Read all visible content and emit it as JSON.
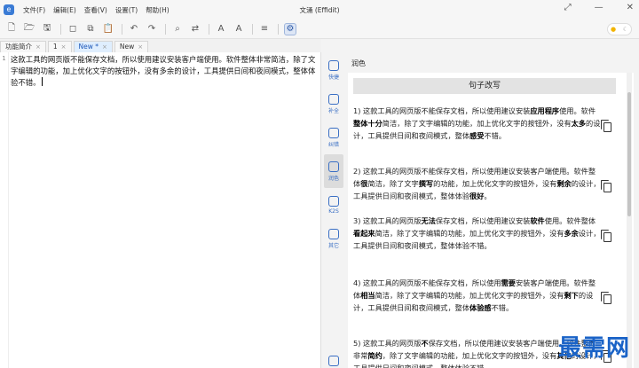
{
  "window": {
    "title": "文涌 (Effidit)",
    "menu": [
      "文件(F)",
      "编辑(E)",
      "查看(V)",
      "设置(T)",
      "帮助(H)"
    ]
  },
  "tabs": [
    {
      "label": "功能简介",
      "active": false
    },
    {
      "label": "1",
      "active": false
    },
    {
      "label": "New *",
      "active": true
    },
    {
      "label": "New",
      "active": false
    }
  ],
  "editor": {
    "line_number": "1",
    "text": "这款工具的网页版不能保存文档，所以使用建议安装客户端使用。软件整体非常简洁，除了文字编辑的功能，加上优化文字的按钮外，没有多余的设计，工具提供日间和夜间模式，整体体验不错。"
  },
  "sidenav": [
    {
      "label": "快捷"
    },
    {
      "label": "补全"
    },
    {
      "label": "纠错"
    },
    {
      "label": "润色",
      "active": true
    },
    {
      "label": "K2S"
    },
    {
      "label": "其它"
    }
  ],
  "panel": {
    "title": "润色",
    "header": "句子改写",
    "suggestions": [
      {
        "segments": [
          {
            "t": "1) 这款工具的网页版不能保存文档，所以使用建议安装"
          },
          {
            "t": "应用程序",
            "b": true
          },
          {
            "t": "使用。软件"
          },
          {
            "t": "整体十分",
            "b": true
          },
          {
            "t": "简洁，除了文字编辑的功能，加上优化文字的按钮外，没有"
          },
          {
            "t": "太多",
            "b": true
          },
          {
            "t": "的设计，工具提供日间和夜间模式，整体"
          },
          {
            "t": "感受",
            "b": true
          },
          {
            "t": "不错。"
          }
        ]
      },
      {
        "segments": [
          {
            "t": "2) 这款工具的网页版不能保存文档，所以使用建议安装客户端使用。软件整体"
          },
          {
            "t": "很",
            "b": true
          },
          {
            "t": "简洁，除了文字"
          },
          {
            "t": "撰写",
            "b": true
          },
          {
            "t": "的功能，加上优化文字的按钮外，没有"
          },
          {
            "t": "剩余",
            "b": true
          },
          {
            "t": "的设计，工具提供日间和夜间模式，整体体验"
          },
          {
            "t": "很好",
            "b": true
          },
          {
            "t": "。"
          }
        ]
      },
      {
        "segments": [
          {
            "t": "3) 这款工具的网页版"
          },
          {
            "t": "无法",
            "b": true
          },
          {
            "t": "保存文档，所以使用建议安装"
          },
          {
            "t": "软件",
            "b": true
          },
          {
            "t": "使用。软件整体"
          },
          {
            "t": "看起来",
            "b": true
          },
          {
            "t": "简洁，除了文字编辑的功能，加上优化文字的按钮外，没有"
          },
          {
            "t": "多余",
            "b": true
          },
          {
            "t": "设计，工具提供日间和夜间模式，整体体验不错。"
          }
        ]
      },
      {
        "segments": [
          {
            "t": "4) 这款工具的网页版不能保存文档，所以使用"
          },
          {
            "t": "需要",
            "b": true
          },
          {
            "t": "安装客户端使用。软件整体"
          },
          {
            "t": "相当",
            "b": true
          },
          {
            "t": "简洁，除了文字编辑的功能，加上优化文字的按钮外，没有"
          },
          {
            "t": "剩下",
            "b": true
          },
          {
            "t": "的设计，工具提供日间和夜间模式，整体"
          },
          {
            "t": "体验感",
            "b": true
          },
          {
            "t": "不错。"
          }
        ]
      },
      {
        "segments": [
          {
            "t": "5) 这款工具的网页版"
          },
          {
            "t": "不",
            "b": true
          },
          {
            "t": "保存文档，所以使用建议安装客户端使用。软件整体非常"
          },
          {
            "t": "简约",
            "b": true
          },
          {
            "t": "，除了文字编辑的功能，加上优化文字的按钮外，没有"
          },
          {
            "t": "其他",
            "b": true
          },
          {
            "t": "的设计，工具提供日间和夜间模式，整体体验不错。"
          }
        ]
      }
    ]
  },
  "watermark": "最需网",
  "colors": {
    "accent": "#3a6fc4",
    "tab_active_bg": "#dfeefe",
    "watermark": "#1a63c7"
  }
}
